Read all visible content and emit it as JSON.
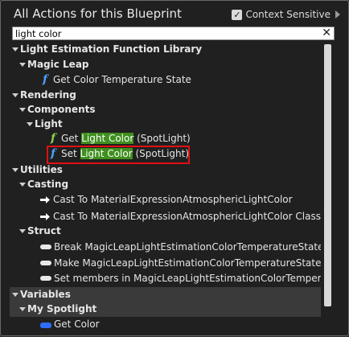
{
  "header": {
    "title": "All Actions for this Blueprint",
    "context_sensitive_label": "Context Sensitive",
    "context_sensitive_checked": true
  },
  "search": {
    "value": "light color",
    "clear_symbol": "✕"
  },
  "tree": {
    "light_estimation": "Light Estimation Function Library",
    "magic_leap": "Magic Leap",
    "get_color_temp": "Get Color Temperature State",
    "rendering": "Rendering",
    "components": "Components",
    "light": "Light",
    "get_prefix": "Get ",
    "get_match": "Light Color",
    "get_suffix": " (SpotLight)",
    "set_prefix": "Set ",
    "set_match": "Light Color",
    "set_suffix": " (SpotLight)",
    "utilities": "Utilities",
    "casting": "Casting",
    "cast1": "Cast To MaterialExpressionAtmosphericLightColor",
    "cast2": "Cast To MaterialExpressionAtmosphericLightColor Class",
    "struct": "Struct",
    "break": "Break MagicLeapLightEstimationColorTemperatureState",
    "make": "Make MagicLeapLightEstimationColorTemperatureState",
    "set_members": "Set members in MagicLeapLightEstimationColorTempera",
    "variables": "Variables",
    "my_spotlight": "My Spotlight",
    "get_color": "Get Color"
  },
  "icons": {
    "function": "f",
    "checkmark": "✓"
  },
  "colors": {
    "match_highlight": "#3f8f1e",
    "function_blue": "#4ba3ff",
    "function_green": "#8bd64a",
    "selection_box": "#e01010"
  }
}
